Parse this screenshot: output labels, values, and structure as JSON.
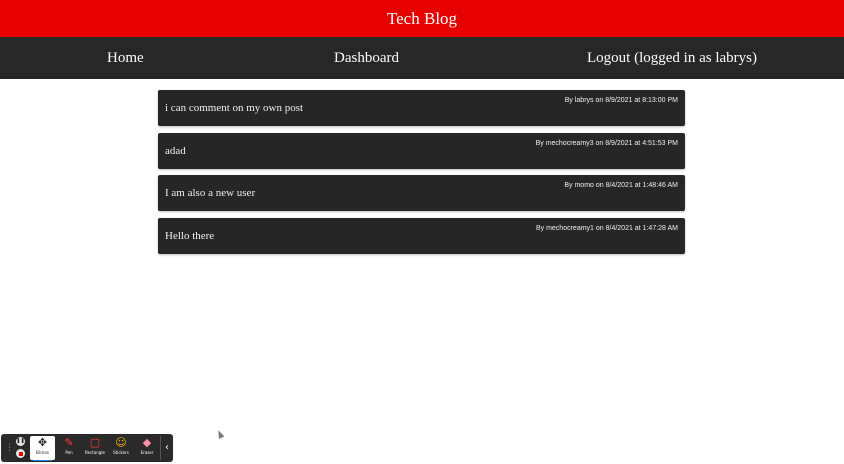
{
  "header": {
    "title": "Tech Blog"
  },
  "nav": {
    "home": "Home",
    "dashboard": "Dashboard",
    "logout": "Logout (logged in as labrys)"
  },
  "posts": [
    {
      "title": "i can comment on my own post",
      "meta": "By labrys on 8/9/2021 at 8:13:00 PM"
    },
    {
      "title": "adad",
      "meta": "By mechocreamy3 on 8/9/2021 at 4:51:53 PM"
    },
    {
      "title": "I am also a new user",
      "meta": "By momo on 8/4/2021 at 1:48:46 AM"
    },
    {
      "title": "Hello there",
      "meta": "By mechocreamy1 on 8/4/2021 at 1:47:28 AM"
    }
  ],
  "toolbar": {
    "select_label": "Ellman",
    "pen_label": "Pen",
    "rectangle_label": "Rectangle",
    "stickers_label": "Stickers",
    "eraser_label": "Eraser"
  },
  "colors": {
    "header_bg": "#e60000",
    "nav_bg": "#272727",
    "card_bg": "#262626"
  }
}
